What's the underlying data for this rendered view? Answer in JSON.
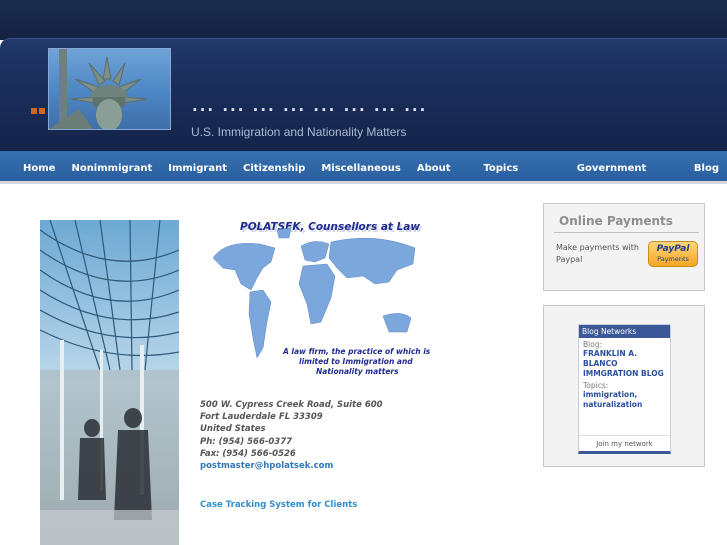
{
  "header": {
    "title": "... ... ... ... ... ... ... ...",
    "subtitle": "U.S. Immigration and Nationality Matters"
  },
  "nav": {
    "items": [
      "Home",
      "Nonimmigrant",
      "Immigrant",
      "Citizenship",
      "Miscellaneous",
      "About Us",
      "Topics Library",
      "Government Links",
      "Blog"
    ]
  },
  "logo": {
    "firm_name": "POLATSEK, Counsellors at Law",
    "tagline_1": "A law firm, the practice of which is",
    "tagline_2": "limited to Immigration and",
    "tagline_3": "Nationality matters"
  },
  "address": {
    "line1": "500 W. Cypress Creek Road, Suite 600",
    "line2": "Fort Lauderdale FL 33309",
    "line3": "United States",
    "phone": "Ph: (954) 566-0377",
    "fax": "Fax: (954) 566-0526",
    "email": "postmaster@hpolatsek.com"
  },
  "case_link": "Case Tracking System for Clients",
  "payments": {
    "title": "Online Payments",
    "text": "Make payments with Paypal",
    "paypal_label": "PayPal",
    "paypal_sub": "Payments"
  },
  "network": {
    "header": "Blog Networks",
    "blog_label": "Blog:",
    "blog_name": "FRANKLIN A. BLANCO IMMGRATION BLOG",
    "topics_label": "Topics:",
    "topics": "immigration, naturalization",
    "join": "Join my network"
  },
  "colors": {
    "nav_bg": "#2f67a6",
    "header_bg": "#1a2d59",
    "link": "#2f8fd0",
    "accent_orange": "#d2641c"
  }
}
